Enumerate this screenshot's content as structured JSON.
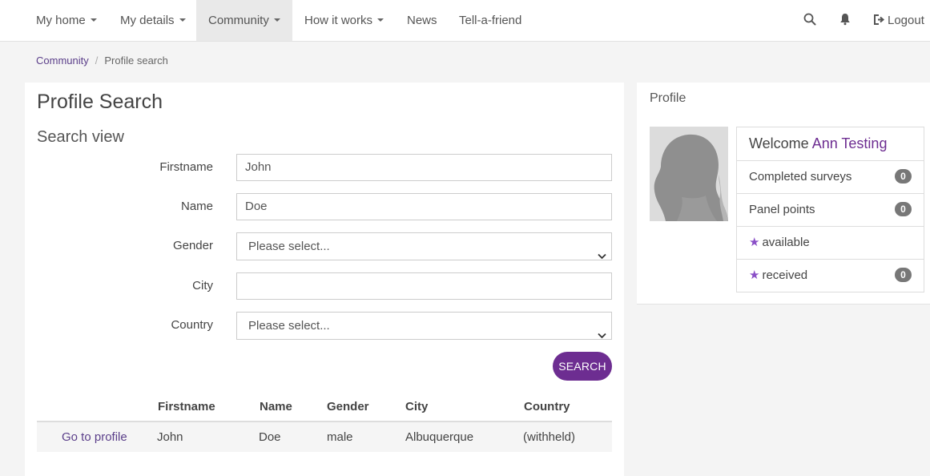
{
  "nav": {
    "items": [
      {
        "label": "My home",
        "dropdown": true
      },
      {
        "label": "My details",
        "dropdown": true
      },
      {
        "label": "Community",
        "dropdown": true,
        "active": true
      },
      {
        "label": "How it works",
        "dropdown": true
      },
      {
        "label": "News",
        "dropdown": false
      },
      {
        "label": "Tell-a-friend",
        "dropdown": false
      }
    ],
    "icons": [
      "search-icon",
      "bell-icon"
    ],
    "logout_label": "Logout"
  },
  "breadcrumb": {
    "parent": "Community",
    "separator": "/",
    "current": "Profile search"
  },
  "main": {
    "title": "Profile Search",
    "section_title": "Search view",
    "form": {
      "firstname": {
        "label": "Firstname",
        "value": "John"
      },
      "name": {
        "label": "Name",
        "value": "Doe"
      },
      "gender": {
        "label": "Gender",
        "selected": "Please select..."
      },
      "city": {
        "label": "City",
        "value": ""
      },
      "country": {
        "label": "Country",
        "selected": "Please select..."
      }
    },
    "search_button": "SEARCH",
    "table": {
      "headers": [
        "Firstname",
        "Name",
        "Gender",
        "City",
        "Country"
      ],
      "rows": [
        {
          "action": "Go to profile",
          "firstname": "John",
          "name": "Doe",
          "gender": "male",
          "city": "Albuquerque",
          "country": "(withheld)"
        }
      ]
    }
  },
  "profile": {
    "heading": "Profile",
    "welcome_prefix": "Welcome",
    "user_name": "Ann Testing",
    "stats": [
      {
        "label": "Completed surveys",
        "count": "0"
      },
      {
        "label": "Panel points",
        "count": "0"
      },
      {
        "label": "available",
        "star": true
      },
      {
        "label": "received",
        "star": true,
        "count": "0"
      }
    ]
  },
  "colors": {
    "accent": "#6d2d91",
    "link": "#5b3f8a",
    "star": "#8a4fc7",
    "badge": "#777777",
    "background": "#f4f4f4"
  }
}
